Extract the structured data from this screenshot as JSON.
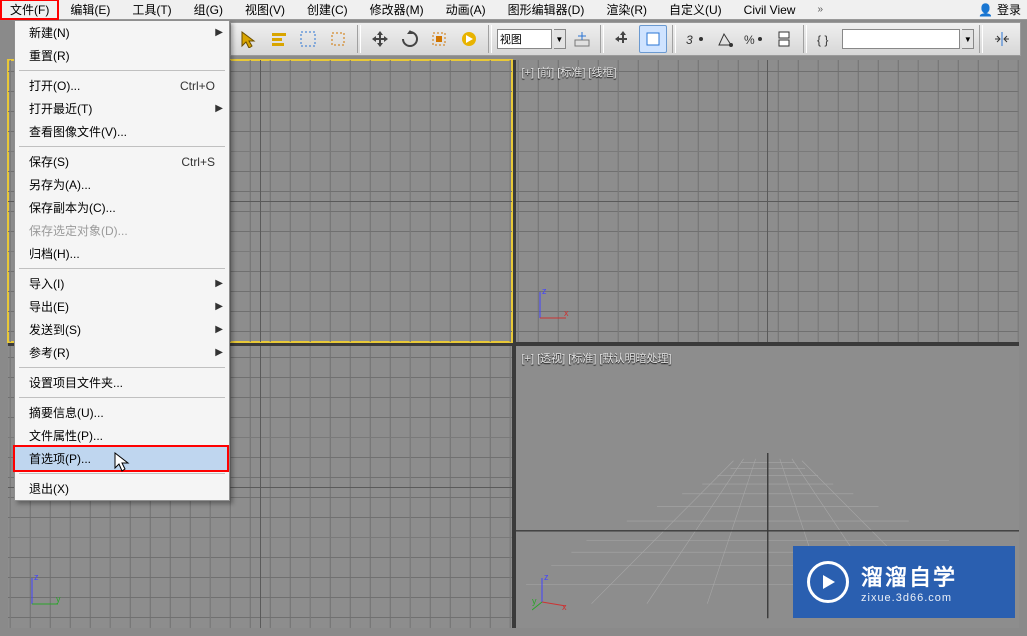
{
  "menubar": {
    "items": [
      "文件(F)",
      "编辑(E)",
      "工具(T)",
      "组(G)",
      "视图(V)",
      "创建(C)",
      "修改器(M)",
      "动画(A)",
      "图形编辑器(D)",
      "渲染(R)",
      "自定义(U)",
      "Civil View"
    ],
    "overflow": "»",
    "login_icon": "👤",
    "login": "登录"
  },
  "toolbar": {
    "view_input": "视图"
  },
  "file_menu": [
    {
      "label": "新建(N)",
      "sub": true
    },
    {
      "label": "重置(R)"
    },
    {
      "sep": true
    },
    {
      "label": "打开(O)...",
      "short": "Ctrl+O"
    },
    {
      "label": "打开最近(T)",
      "sub": true
    },
    {
      "label": "查看图像文件(V)..."
    },
    {
      "sep": true
    },
    {
      "label": "保存(S)",
      "short": "Ctrl+S"
    },
    {
      "label": "另存为(A)..."
    },
    {
      "label": "保存副本为(C)..."
    },
    {
      "label": "保存选定对象(D)...",
      "disabled": true
    },
    {
      "label": "归档(H)..."
    },
    {
      "sep": true
    },
    {
      "label": "导入(I)",
      "sub": true
    },
    {
      "label": "导出(E)",
      "sub": true
    },
    {
      "label": "发送到(S)",
      "sub": true
    },
    {
      "label": "参考(R)",
      "sub": true
    },
    {
      "sep": true
    },
    {
      "label": "设置项目文件夹..."
    },
    {
      "sep": true
    },
    {
      "label": "摘要信息(U)..."
    },
    {
      "label": "文件属性(P)..."
    },
    {
      "label": "首选项(P)...",
      "highlight": true,
      "hover": true
    },
    {
      "sep": true
    },
    {
      "label": "退出(X)"
    }
  ],
  "viewports": {
    "top_left": "",
    "top_right": "[+] [前] [标准] [线框]",
    "bottom_left": "",
    "bottom_right": "[+] [透视] [标准] [默认明暗处理]"
  },
  "watermark": {
    "title": "溜溜自学",
    "sub": "zixue.3d66.com"
  }
}
